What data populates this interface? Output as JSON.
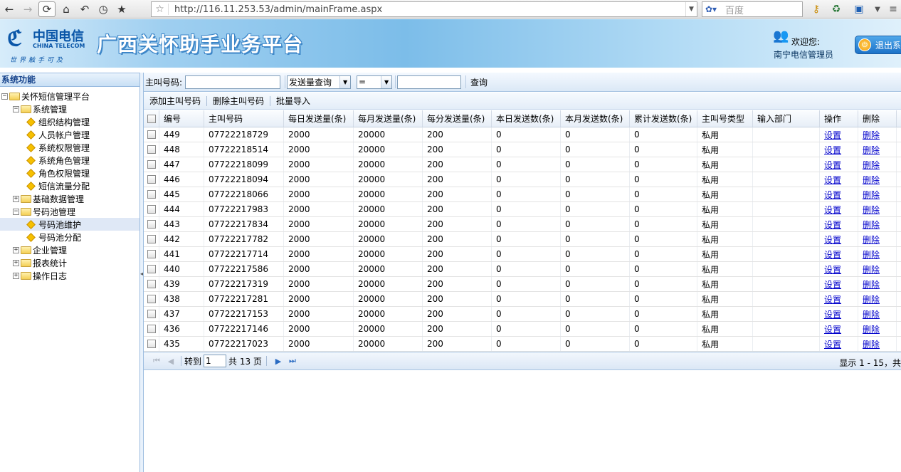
{
  "browser": {
    "url": "http://116.11.253.53/admin/mainFrame.aspx",
    "search_placeholder": "百度",
    "search_engine_icon": "paw-icon"
  },
  "header": {
    "logo_cn": "中国电信",
    "logo_en": "CHINA TELECOM",
    "logo_slogan": "世界触手可及",
    "title": "广西关怀助手业务平台",
    "welcome": "欢迎您:",
    "username": "南宁电信管理员",
    "logout_label": "退出系"
  },
  "sidebar": {
    "title": "系统功能",
    "tree": [
      {
        "label": "关怀短信管理平台",
        "level": 0,
        "toggle": "−",
        "type": "folder"
      },
      {
        "label": "系统管理",
        "level": 1,
        "toggle": "−",
        "type": "folder"
      },
      {
        "label": "组织结构管理",
        "level": 2,
        "type": "leaf"
      },
      {
        "label": "人员帐户管理",
        "level": 2,
        "type": "leaf"
      },
      {
        "label": "系统权限管理",
        "level": 2,
        "type": "leaf"
      },
      {
        "label": "系统角色管理",
        "level": 2,
        "type": "leaf"
      },
      {
        "label": "角色权限管理",
        "level": 2,
        "type": "leaf"
      },
      {
        "label": "短信流量分配",
        "level": 2,
        "type": "leaf"
      },
      {
        "label": "基础数据管理",
        "level": 1,
        "toggle": "+",
        "type": "folder"
      },
      {
        "label": "号码池管理",
        "level": 1,
        "toggle": "−",
        "type": "folder"
      },
      {
        "label": "号码池维护",
        "level": 2,
        "type": "leaf",
        "selected": true
      },
      {
        "label": "号码池分配",
        "level": 2,
        "type": "leaf"
      },
      {
        "label": "企业管理",
        "level": 1,
        "toggle": "+",
        "type": "folder"
      },
      {
        "label": "报表统计",
        "level": 1,
        "toggle": "+",
        "type": "folder"
      },
      {
        "label": "操作日志",
        "level": 1,
        "toggle": "+",
        "type": "folder"
      }
    ]
  },
  "query": {
    "phone_label": "主叫号码:",
    "phone_value": "",
    "field_select": "发送量查询",
    "operator_select": "=",
    "value": "",
    "search_label": "查询"
  },
  "toolbar": {
    "add_label": "添加主叫号码",
    "delete_label": "删除主叫号码",
    "import_label": "批量导入"
  },
  "table": {
    "columns": [
      "编号",
      "主叫号码",
      "每日发送量(条)",
      "每月发送量(条)",
      "每分发送量(条)",
      "本日发送数(条)",
      "本月发送数(条)",
      "累计发送数(条)",
      "主叫号类型",
      "输入部门",
      "操作",
      "删除"
    ],
    "rows": [
      [
        "449",
        "07722218729",
        "2000",
        "20000",
        "200",
        "0",
        "0",
        "0",
        "私用",
        "",
        "设置",
        "删除"
      ],
      [
        "448",
        "07722218514",
        "2000",
        "20000",
        "200",
        "0",
        "0",
        "0",
        "私用",
        "",
        "设置",
        "删除"
      ],
      [
        "447",
        "07722218099",
        "2000",
        "20000",
        "200",
        "0",
        "0",
        "0",
        "私用",
        "",
        "设置",
        "删除"
      ],
      [
        "446",
        "07722218094",
        "2000",
        "20000",
        "200",
        "0",
        "0",
        "0",
        "私用",
        "",
        "设置",
        "删除"
      ],
      [
        "445",
        "07722218066",
        "2000",
        "20000",
        "200",
        "0",
        "0",
        "0",
        "私用",
        "",
        "设置",
        "删除"
      ],
      [
        "444",
        "07722217983",
        "2000",
        "20000",
        "200",
        "0",
        "0",
        "0",
        "私用",
        "",
        "设置",
        "删除"
      ],
      [
        "443",
        "07722217834",
        "2000",
        "20000",
        "200",
        "0",
        "0",
        "0",
        "私用",
        "",
        "设置",
        "删除"
      ],
      [
        "442",
        "07722217782",
        "2000",
        "20000",
        "200",
        "0",
        "0",
        "0",
        "私用",
        "",
        "设置",
        "删除"
      ],
      [
        "441",
        "07722217714",
        "2000",
        "20000",
        "200",
        "0",
        "0",
        "0",
        "私用",
        "",
        "设置",
        "删除"
      ],
      [
        "440",
        "07722217586",
        "2000",
        "20000",
        "200",
        "0",
        "0",
        "0",
        "私用",
        "",
        "设置",
        "删除"
      ],
      [
        "439",
        "07722217319",
        "2000",
        "20000",
        "200",
        "0",
        "0",
        "0",
        "私用",
        "",
        "设置",
        "删除"
      ],
      [
        "438",
        "07722217281",
        "2000",
        "20000",
        "200",
        "0",
        "0",
        "0",
        "私用",
        "",
        "设置",
        "删除"
      ],
      [
        "437",
        "07722217153",
        "2000",
        "20000",
        "200",
        "0",
        "0",
        "0",
        "私用",
        "",
        "设置",
        "删除"
      ],
      [
        "436",
        "07722217146",
        "2000",
        "20000",
        "200",
        "0",
        "0",
        "0",
        "私用",
        "",
        "设置",
        "删除"
      ],
      [
        "435",
        "07722217023",
        "2000",
        "20000",
        "200",
        "0",
        "0",
        "0",
        "私用",
        "",
        "设置",
        "删除"
      ]
    ]
  },
  "pager": {
    "goto_label": "转到",
    "page_value": "1",
    "total_label": "共 13 页",
    "info": "显示 1 - 15，共"
  },
  "colors": {
    "accent": "#15428b",
    "link": "#0000cc",
    "banner": "#7cbde9"
  }
}
